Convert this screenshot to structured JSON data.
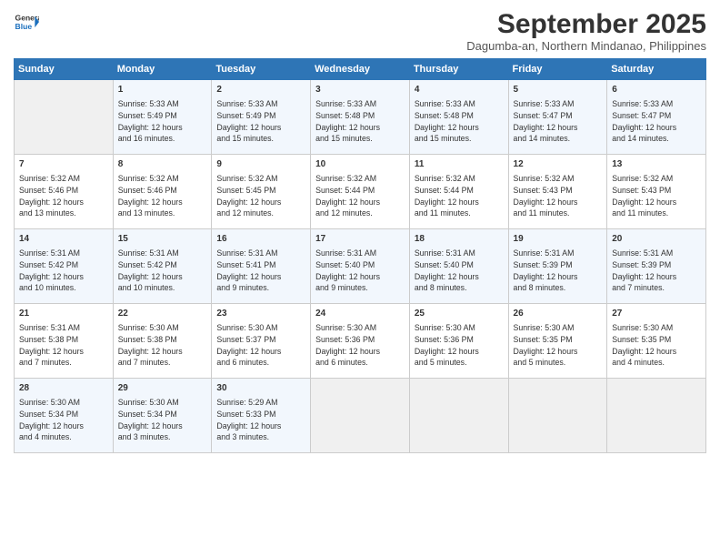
{
  "logo": {
    "line1": "General",
    "line2": "Blue"
  },
  "title": "September 2025",
  "location": "Dagumba-an, Northern Mindanao, Philippines",
  "days_of_week": [
    "Sunday",
    "Monday",
    "Tuesday",
    "Wednesday",
    "Thursday",
    "Friday",
    "Saturday"
  ],
  "weeks": [
    [
      {
        "day": "",
        "info": ""
      },
      {
        "day": "1",
        "info": "Sunrise: 5:33 AM\nSunset: 5:49 PM\nDaylight: 12 hours\nand 16 minutes."
      },
      {
        "day": "2",
        "info": "Sunrise: 5:33 AM\nSunset: 5:49 PM\nDaylight: 12 hours\nand 15 minutes."
      },
      {
        "day": "3",
        "info": "Sunrise: 5:33 AM\nSunset: 5:48 PM\nDaylight: 12 hours\nand 15 minutes."
      },
      {
        "day": "4",
        "info": "Sunrise: 5:33 AM\nSunset: 5:48 PM\nDaylight: 12 hours\nand 15 minutes."
      },
      {
        "day": "5",
        "info": "Sunrise: 5:33 AM\nSunset: 5:47 PM\nDaylight: 12 hours\nand 14 minutes."
      },
      {
        "day": "6",
        "info": "Sunrise: 5:33 AM\nSunset: 5:47 PM\nDaylight: 12 hours\nand 14 minutes."
      }
    ],
    [
      {
        "day": "7",
        "info": "Sunrise: 5:32 AM\nSunset: 5:46 PM\nDaylight: 12 hours\nand 13 minutes."
      },
      {
        "day": "8",
        "info": "Sunrise: 5:32 AM\nSunset: 5:46 PM\nDaylight: 12 hours\nand 13 minutes."
      },
      {
        "day": "9",
        "info": "Sunrise: 5:32 AM\nSunset: 5:45 PM\nDaylight: 12 hours\nand 12 minutes."
      },
      {
        "day": "10",
        "info": "Sunrise: 5:32 AM\nSunset: 5:44 PM\nDaylight: 12 hours\nand 12 minutes."
      },
      {
        "day": "11",
        "info": "Sunrise: 5:32 AM\nSunset: 5:44 PM\nDaylight: 12 hours\nand 11 minutes."
      },
      {
        "day": "12",
        "info": "Sunrise: 5:32 AM\nSunset: 5:43 PM\nDaylight: 12 hours\nand 11 minutes."
      },
      {
        "day": "13",
        "info": "Sunrise: 5:32 AM\nSunset: 5:43 PM\nDaylight: 12 hours\nand 11 minutes."
      }
    ],
    [
      {
        "day": "14",
        "info": "Sunrise: 5:31 AM\nSunset: 5:42 PM\nDaylight: 12 hours\nand 10 minutes."
      },
      {
        "day": "15",
        "info": "Sunrise: 5:31 AM\nSunset: 5:42 PM\nDaylight: 12 hours\nand 10 minutes."
      },
      {
        "day": "16",
        "info": "Sunrise: 5:31 AM\nSunset: 5:41 PM\nDaylight: 12 hours\nand 9 minutes."
      },
      {
        "day": "17",
        "info": "Sunrise: 5:31 AM\nSunset: 5:40 PM\nDaylight: 12 hours\nand 9 minutes."
      },
      {
        "day": "18",
        "info": "Sunrise: 5:31 AM\nSunset: 5:40 PM\nDaylight: 12 hours\nand 8 minutes."
      },
      {
        "day": "19",
        "info": "Sunrise: 5:31 AM\nSunset: 5:39 PM\nDaylight: 12 hours\nand 8 minutes."
      },
      {
        "day": "20",
        "info": "Sunrise: 5:31 AM\nSunset: 5:39 PM\nDaylight: 12 hours\nand 7 minutes."
      }
    ],
    [
      {
        "day": "21",
        "info": "Sunrise: 5:31 AM\nSunset: 5:38 PM\nDaylight: 12 hours\nand 7 minutes."
      },
      {
        "day": "22",
        "info": "Sunrise: 5:30 AM\nSunset: 5:38 PM\nDaylight: 12 hours\nand 7 minutes."
      },
      {
        "day": "23",
        "info": "Sunrise: 5:30 AM\nSunset: 5:37 PM\nDaylight: 12 hours\nand 6 minutes."
      },
      {
        "day": "24",
        "info": "Sunrise: 5:30 AM\nSunset: 5:36 PM\nDaylight: 12 hours\nand 6 minutes."
      },
      {
        "day": "25",
        "info": "Sunrise: 5:30 AM\nSunset: 5:36 PM\nDaylight: 12 hours\nand 5 minutes."
      },
      {
        "day": "26",
        "info": "Sunrise: 5:30 AM\nSunset: 5:35 PM\nDaylight: 12 hours\nand 5 minutes."
      },
      {
        "day": "27",
        "info": "Sunrise: 5:30 AM\nSunset: 5:35 PM\nDaylight: 12 hours\nand 4 minutes."
      }
    ],
    [
      {
        "day": "28",
        "info": "Sunrise: 5:30 AM\nSunset: 5:34 PM\nDaylight: 12 hours\nand 4 minutes."
      },
      {
        "day": "29",
        "info": "Sunrise: 5:30 AM\nSunset: 5:34 PM\nDaylight: 12 hours\nand 3 minutes."
      },
      {
        "day": "30",
        "info": "Sunrise: 5:29 AM\nSunset: 5:33 PM\nDaylight: 12 hours\nand 3 minutes."
      },
      {
        "day": "",
        "info": ""
      },
      {
        "day": "",
        "info": ""
      },
      {
        "day": "",
        "info": ""
      },
      {
        "day": "",
        "info": ""
      }
    ]
  ]
}
